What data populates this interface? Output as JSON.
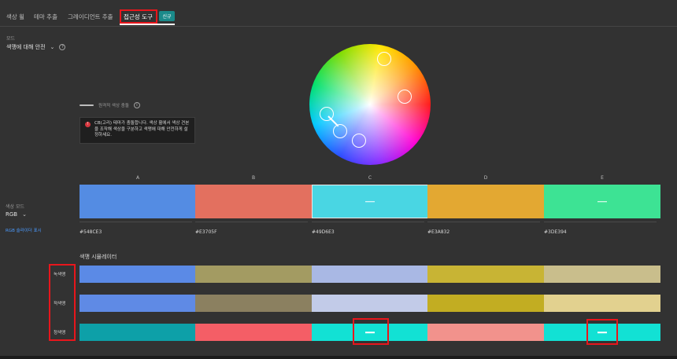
{
  "tabs": [
    {
      "label": "색상 휠"
    },
    {
      "label": "테마 추출"
    },
    {
      "label": "그레이디언트 추출"
    },
    {
      "label": "접근성 도구"
    }
  ],
  "badge": "신규",
  "mode": {
    "label": "모드",
    "value": "색맹에 대해 안전"
  },
  "toggle_label": "원격적 색상 충돌",
  "alert": {
    "text": "CB(고리) 테마가 충돌합니다. 색상 휠에서 색상 견본을 조작해 색상을 구분하고 색맹에 대해 안전하게 설정하세요."
  },
  "color_mode": {
    "label": "색상 모드",
    "value": "RGB",
    "link": "RGB 슬라이더 표시"
  },
  "columns": [
    {
      "letter": "A",
      "hex": "#548CE3",
      "color": "#548CE3"
    },
    {
      "letter": "B",
      "hex": "#E3705F",
      "color": "#E3705F"
    },
    {
      "letter": "C",
      "hex": "#49D6E3",
      "color": "#49D6E3"
    },
    {
      "letter": "D",
      "hex": "#E3A832",
      "color": "#E3A832"
    },
    {
      "letter": "E",
      "hex": "#3DE394",
      "color": "#3DE394"
    }
  ],
  "simulator": {
    "title": "색맹 시뮬레이터",
    "rows": [
      {
        "label": "녹색맹",
        "colors": [
          "#5b8ae6",
          "#a39b62",
          "#a9b8e4",
          "#c8b434",
          "#c9be8c"
        ]
      },
      {
        "label": "적색맹",
        "colors": [
          "#5f8ae5",
          "#8b8060",
          "#c2cbe8",
          "#c2ad22",
          "#e2d18f"
        ]
      },
      {
        "label": "청색맹",
        "colors": [
          "#0da0a8",
          "#f45e66",
          "#12e1d4",
          "#f2928c",
          "#12e1d4"
        ]
      }
    ]
  },
  "colors": {
    "background": "#323232",
    "highlight_box": "#e8161c",
    "badge": "#1a8a8a",
    "link": "#4b9bff"
  }
}
